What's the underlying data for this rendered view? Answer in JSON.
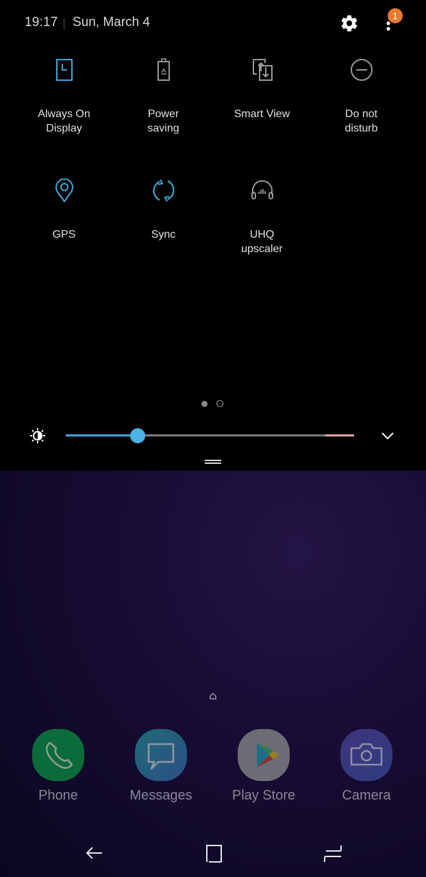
{
  "status": {
    "time": "19:17",
    "date": "Sun, March 4",
    "settings_icon": "gear-icon",
    "more_icon": "more-vertical-icon",
    "notification_badge": "1",
    "badge_color": "#e8782a"
  },
  "quick_settings": {
    "page": 1,
    "page_count": 2,
    "tiles": [
      {
        "label": "Always On Display",
        "line1": "Always On",
        "line2": "Display",
        "icon": "always-on-display-icon",
        "active": true
      },
      {
        "label": "Power saving",
        "line1": "Power",
        "line2": "saving",
        "icon": "battery-recycle-icon",
        "active": false
      },
      {
        "label": "Smart View",
        "line1": "Smart View",
        "line2": "",
        "icon": "smart-view-icon",
        "active": false
      },
      {
        "label": "Do not disturb",
        "line1": "Do not",
        "line2": "disturb",
        "icon": "do-not-disturb-icon",
        "active": false
      },
      {
        "label": "GPS",
        "line1": "GPS",
        "line2": "",
        "icon": "location-pin-icon",
        "active": true
      },
      {
        "label": "Sync",
        "line1": "Sync",
        "line2": "",
        "icon": "sync-icon",
        "active": true
      },
      {
        "label": "UHQ upscaler",
        "line1": "UHQ",
        "line2": "upscaler",
        "icon": "headphones-icon",
        "active": false
      }
    ],
    "active_color": "#3fa9dd",
    "inactive_color": "#9a9a9a"
  },
  "brightness": {
    "icon": "brightness-icon",
    "value_fraction": 0.25,
    "expand_icon": "chevron-down-icon"
  },
  "home": {
    "dock": [
      {
        "label": "Phone",
        "icon": "phone-icon"
      },
      {
        "label": "Messages",
        "icon": "messages-icon"
      },
      {
        "label": "Play Store",
        "icon": "play-store-icon"
      },
      {
        "label": "Camera",
        "icon": "camera-icon"
      }
    ]
  },
  "navbar": {
    "back": "back-arrow-icon",
    "home": "home-button-icon",
    "recents": "recents-icon"
  }
}
